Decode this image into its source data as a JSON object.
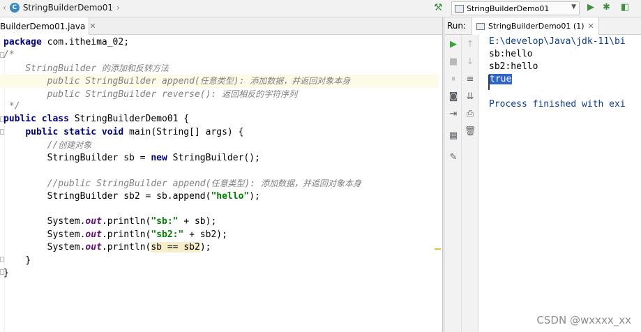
{
  "topbar": {
    "breadcrumb": "StringBuilderDemo01",
    "run_config": "StringBuilderDemo01"
  },
  "editor_tab": {
    "title": "BuilderDemo01.java"
  },
  "code": {
    "l1_kw": "package",
    "l1_rest": " com.itheima_02;",
    "l2": "/*",
    "l3_prefix": "    StringBuilder ",
    "l3_cn": "的添加和反转方法",
    "l4_prefix": "        public StringBuilder append(",
    "l4_cn1": "任意类型",
    "l4_mid": "): ",
    "l4_cn2": "添加数据，并返回对象本身",
    "l5_prefix": "        public StringBuilder reverse(): ",
    "l5_cn": "返回相反的字符序列",
    "l6": " */",
    "l7_kw": "public class",
    "l7_rest": " StringBuilderDemo01 {",
    "l8_kw": "public static void",
    "l8_rest": " main(String[] args) {",
    "l9_cmt": "//",
    "l9_cn": "创建对象",
    "l10_a": "StringBuilder sb = ",
    "l10_kw": "new",
    "l10_b": " StringBuilder();",
    "l12_cmt": "//public StringBuilder append(",
    "l12_cn1": "任意类型",
    "l12_mid": "): ",
    "l12_cn2": "添加数据，并返回对象本身",
    "l13_a": "StringBuilder sb2 = sb.append(",
    "l13_str": "\"hello\"",
    "l13_b": ");",
    "l15_a": "System.",
    "l15_fld": "out",
    "l15_b": ".println(",
    "l15_str": "\"sb:\"",
    "l15_c": " + sb);",
    "l16_a": "System.",
    "l16_fld": "out",
    "l16_b": ".println(",
    "l16_str": "\"sb2:\"",
    "l16_c": " + sb2);",
    "l17_a": "System.",
    "l17_fld": "out",
    "l17_b": ".println(",
    "l17_sel": "sb == sb2",
    "l17_c": ");",
    "l18": "}",
    "l19": "}"
  },
  "run_panel": {
    "label": "Run:",
    "tab_title": "StringBuilderDemo01 (1)",
    "output": {
      "path": "E:\\develop\\Java\\jdk-11\\bi",
      "line1": "sb:hello",
      "line2": "sb2:hello",
      "line3": "true",
      "finish": "Process finished with exi"
    }
  },
  "watermark": "CSDN @wxxxx_xx",
  "colors": {
    "keyword": "#000080",
    "string": "#008000",
    "comment": "#808080",
    "field": "#660e7a",
    "selection": "#2f65ca"
  }
}
